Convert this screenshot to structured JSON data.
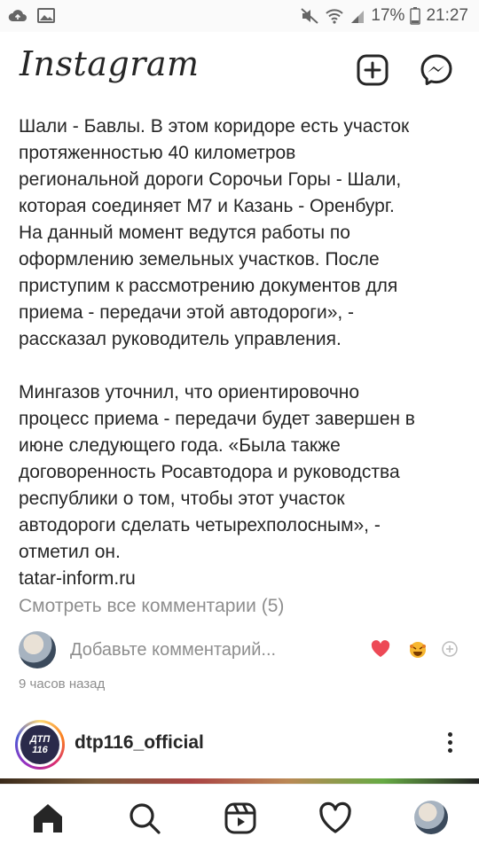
{
  "status_bar": {
    "battery": "17%",
    "time": "21:27"
  },
  "header": {
    "logo": "Instagram",
    "icons": [
      "new-post-icon",
      "messenger-icon"
    ]
  },
  "caption": {
    "partial_line": "Шали - Бавлы. В этом коридоре есть участок",
    "lines_par1": [
      "протяженностью 40 километров",
      "региональной дороги Сорочьи Горы - Шали,",
      "которая соединяет М7 и Казань - Оренбург.",
      "На данный момент ведутся работы по",
      "оформлению земельных участков. После",
      "приступим к рассмотрению документов для",
      "приема - передачи этой автодороги», -",
      "рассказал руководитель управления."
    ],
    "lines_par2": [
      "Мингазов уточнил, что ориентировочно",
      "процесс приема - передачи будет завершен в",
      "июне следующего года. «Была также",
      "договоренность Росавтодора и руководства",
      "республики о том, чтобы этот участок",
      "автодороги сделать четырехполосным», -",
      "отметил он.",
      "tatar-inform.ru"
    ]
  },
  "view_comments": "Смотреть все комментарии (5)",
  "comment_input": {
    "placeholder": "Добавьте комментарий...",
    "reactions": [
      "heart-emoji",
      "laughing-emoji",
      "add-reaction-icon"
    ]
  },
  "timestamp": "9 часов назад",
  "next_post": {
    "username": "dtp116_official",
    "avatar_text_top": "ДТП",
    "avatar_text_bottom": "116"
  },
  "bottom_nav": [
    "home-icon",
    "search-icon",
    "reels-icon",
    "activity-heart-icon",
    "profile-avatar"
  ]
}
